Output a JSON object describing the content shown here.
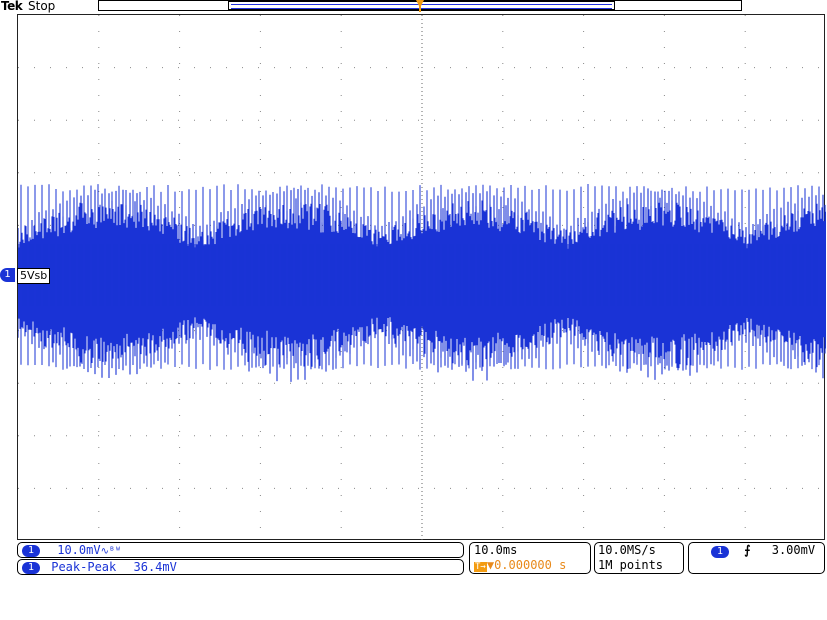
{
  "header": {
    "brand": "Tek",
    "status": "Stop"
  },
  "trigger_marker": "T",
  "channel": {
    "number": "1",
    "label": "5Vsb",
    "color": "#1a33d6"
  },
  "readouts": {
    "vertical_scale": "10.0mV",
    "bandwidth_symbol": "∿ᴮᵂ",
    "measurement_name": "Peak-Peak",
    "measurement_value": "36.4mV",
    "time_per_div": "10.0ms",
    "trigger_position": "▼0.000000 s",
    "sample_rate": "10.0MS/s",
    "record_length": "1M points",
    "trigger_slope": "⨍",
    "trigger_level": "3.00mV"
  },
  "colors": {
    "waveform": "#1a33d6",
    "trigger": "#f39c12",
    "grid": "#888888"
  }
}
